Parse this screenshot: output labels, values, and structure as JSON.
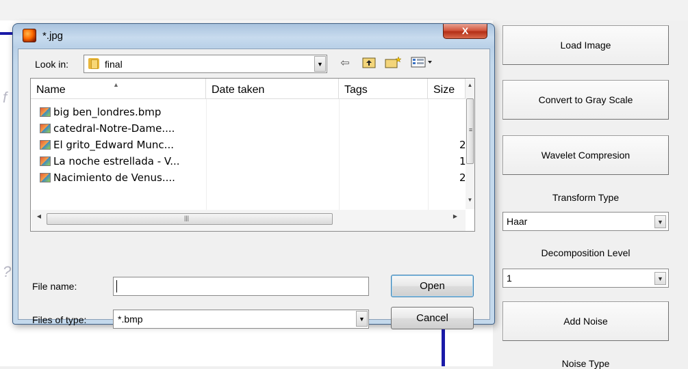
{
  "dialog": {
    "title": "*.jpg",
    "close_label": "X",
    "look_in_label": "Look in:",
    "look_in_value": "final",
    "toolbar": {
      "back_icon": "arrow-left-icon",
      "up_icon": "folder-up-icon",
      "new_folder_icon": "new-folder-icon",
      "view_icon": "view-menu-icon"
    },
    "columns": [
      "Name",
      "Date taken",
      "Tags",
      "Size"
    ],
    "files": [
      {
        "name": "big ben_londres.bmp",
        "size": ""
      },
      {
        "name": "catedral-Notre-Dame....",
        "size": ""
      },
      {
        "name": "El grito_Edward Munc...",
        "size": "2"
      },
      {
        "name": "La noche estrellada - V...",
        "size": "1"
      },
      {
        "name": "Nacimiento de Venus....",
        "size": "2"
      }
    ],
    "file_name_label": "File name:",
    "file_name_value": "",
    "files_of_type_label": "Files of type:",
    "files_of_type_value": "*.bmp",
    "open_label": "Open",
    "cancel_label": "Cancel"
  },
  "panel": {
    "load_image": "Load Image",
    "convert_gray": "Convert to Gray Scale",
    "wavelet_compression": "Wavelet Compresion",
    "transform_type_label": "Transform Type",
    "transform_type_value": "Haar",
    "decomposition_level_label": "Decomposition Level",
    "decomposition_level_value": "1",
    "add_noise": "Add Noise",
    "noise_type_label": "Noise Type"
  },
  "colors": {
    "accent_blue": "#1a1aa8",
    "close_red": "#c7412a",
    "dialog_frame": "#bad1e8"
  }
}
